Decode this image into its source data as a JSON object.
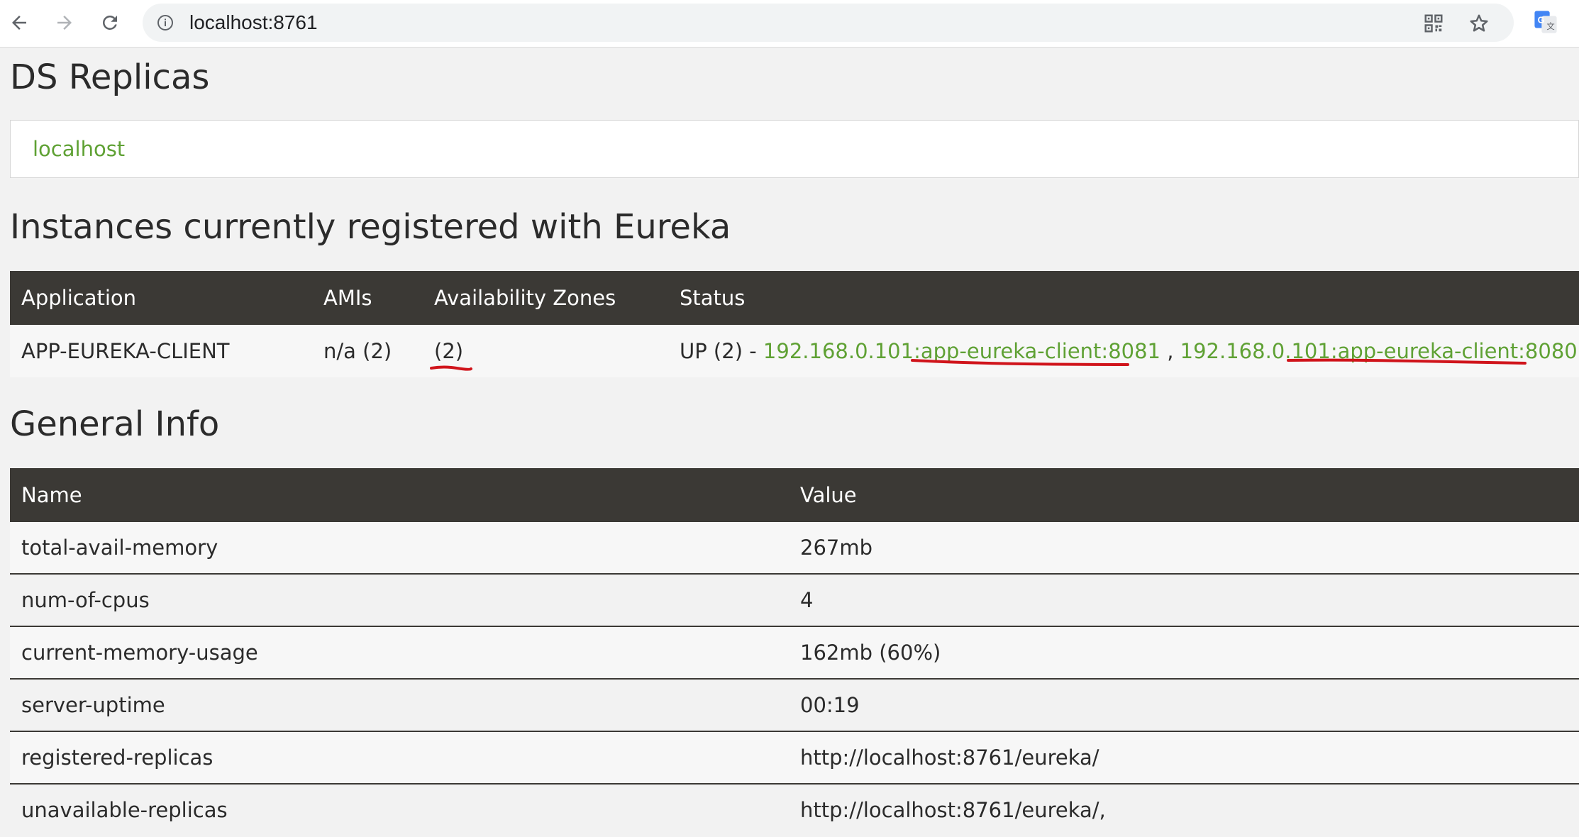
{
  "browser": {
    "url": "localhost:8761",
    "icons": [
      "back-arrow-icon",
      "forward-arrow-icon",
      "reload-icon",
      "site-info-icon",
      "qr-code-icon",
      "bookmark-star-icon",
      "google-translate-icon"
    ]
  },
  "ds_replicas": {
    "title": "DS Replicas",
    "replica": "localhost"
  },
  "instances": {
    "title": "Instances currently registered with Eureka",
    "columns": {
      "application": "Application",
      "amis": "AMIs",
      "zones": "Availability Zones",
      "status": "Status"
    },
    "rows": [
      {
        "application": "APP-EUREKA-CLIENT",
        "amis": "n/a (2)",
        "zones": "(2)",
        "status_prefix": "UP (2) - ",
        "link1": "192.168.0.101:app-eureka-client:8081",
        "separator": " , ",
        "link2": "192.168.0.101:app-eureka-client:8080"
      }
    ]
  },
  "general_info": {
    "title": "General Info",
    "columns": {
      "name": "Name",
      "value": "Value"
    },
    "rows": [
      {
        "name": "total-avail-memory",
        "value": "267mb"
      },
      {
        "name": "num-of-cpus",
        "value": "4"
      },
      {
        "name": "current-memory-usage",
        "value": "162mb (60%)"
      },
      {
        "name": "server-uptime",
        "value": "00:19"
      },
      {
        "name": "registered-replicas",
        "value": "http://localhost:8761/eureka/"
      },
      {
        "name": "unavailable-replicas",
        "value": "http://localhost:8761/eureka/,"
      }
    ]
  },
  "colors": {
    "link_green": "#5fa134",
    "header_dark": "#3b3935",
    "annotation_red": "#d0141b"
  }
}
